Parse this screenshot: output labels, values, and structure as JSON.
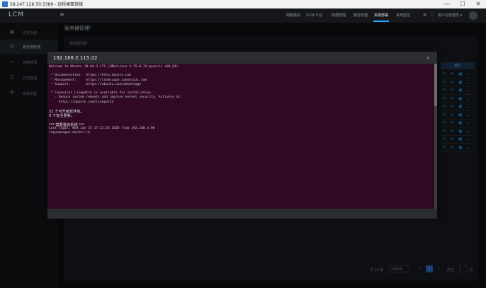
{
  "window": {
    "title": "58.247.128.50:3389 - 远程桌面连接",
    "controls": [
      "—",
      "☐",
      "✕"
    ]
  },
  "header": {
    "logo": "LCM",
    "menu_icon": "≡",
    "nav": [
      {
        "label": "网络模块",
        "active": false
      },
      {
        "label": "GCN 平台",
        "active": false
      },
      {
        "label": "数据管理",
        "active": false
      },
      {
        "label": "服务管理",
        "active": false
      },
      {
        "label": "系统配置",
        "active": false
      },
      {
        "label": "资源部署",
        "active": true
      },
      {
        "label": "系统监控",
        "active": false
      }
    ],
    "user_label": "用户名管理员 ▾"
  },
  "sidebar": {
    "items": [
      {
        "icon": "▣",
        "label": "总览页面",
        "active": false
      },
      {
        "icon": "▤",
        "label": "服务器管理",
        "active": true
      },
      {
        "icon": "▭",
        "label": "存储管理",
        "active": false
      },
      {
        "icon": "◫",
        "label": "日志管理",
        "active": false
      },
      {
        "icon": "✻",
        "label": "系统设置",
        "active": false
      }
    ]
  },
  "main": {
    "page_title": "服务器管理",
    "sub_title": "服务器列表",
    "ops_header": "操作",
    "ops_icons": [
      "✎",
      "✕",
      "▣",
      "⌄"
    ],
    "row_count": 10
  },
  "pagination": {
    "total": "共 10 条",
    "page_size": "10条/页",
    "prev": "‹",
    "current_page": "1",
    "next": "›",
    "goto_label": "前往",
    "goto_suffix": "页"
  },
  "modal": {
    "title": "192.168.2.115:22",
    "close": "×",
    "terminal_lines": [
      "Welcome to Ubuntu 18.04.3 LTS (GNU/Linux 4.15.0-74-generic x86_64)",
      "",
      " * Documentation:  https://help.ubuntu.com",
      " * Management:     https://landscape.canonical.com",
      " * Support:        https://ubuntu.com/advantage",
      "",
      " * Canonical Livepatch is available for installation.",
      "   - Reduce system reboots and improve kernel security. Activate at:",
      "     https://ubuntu.com/livepatch"
    ],
    "cn_lines": [
      "21 个可升级软件包。",
      "0 个安全更新。",
      "",
      "*** 需要重启系统 ***"
    ],
    "tail_lines": [
      "Last login: Wed Jan 15 17:21:55 2020 from 192.168.4.90",
      "rogue@rogue-docker:~$"
    ]
  }
}
